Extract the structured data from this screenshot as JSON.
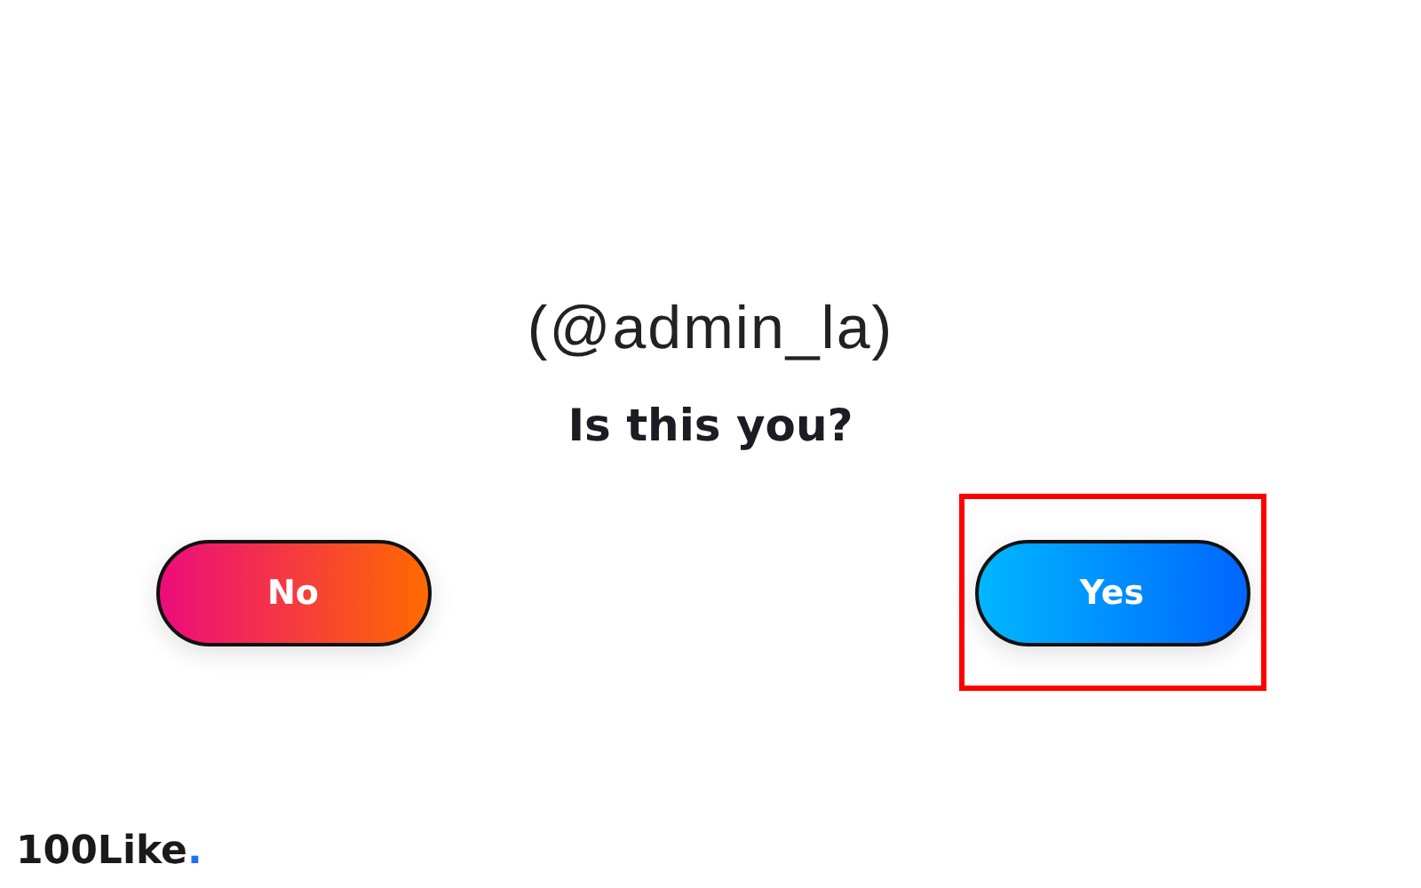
{
  "username": "(@admin_la)",
  "question": "Is this you?",
  "buttons": [
    {
      "label": "No",
      "kind": "warm",
      "highlighted": false
    },
    {
      "label": "Yes",
      "kind": "cool",
      "highlighted": true
    }
  ],
  "logo": {
    "text": "100Like",
    "dot": "."
  }
}
